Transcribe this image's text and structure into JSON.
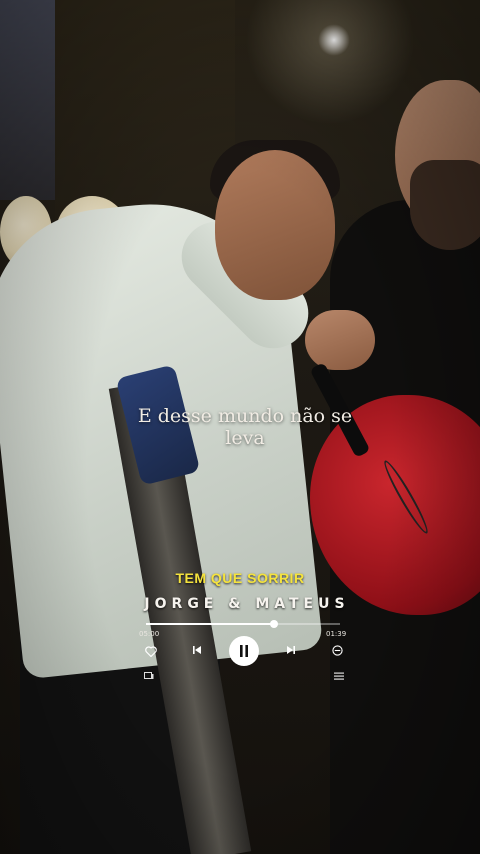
{
  "lyrics": {
    "line1": "E desse mundo não se",
    "line2": "leva"
  },
  "song": {
    "title": "TEM QUE SORRIR",
    "artist": "JORGE & MATEUS"
  },
  "player": {
    "elapsed": "05:00",
    "duration": "01:39",
    "progress_fraction": 0.66
  },
  "icons": {
    "like": "heart-icon",
    "previous": "skip-previous-icon",
    "play_pause": "pause-icon",
    "next": "skip-next-icon",
    "remove": "minus-circle-icon",
    "devices": "devices-icon",
    "queue": "queue-icon"
  },
  "colors": {
    "title": "#f5e33d",
    "artist": "#f6f3ee",
    "accent": "#ffffff"
  }
}
